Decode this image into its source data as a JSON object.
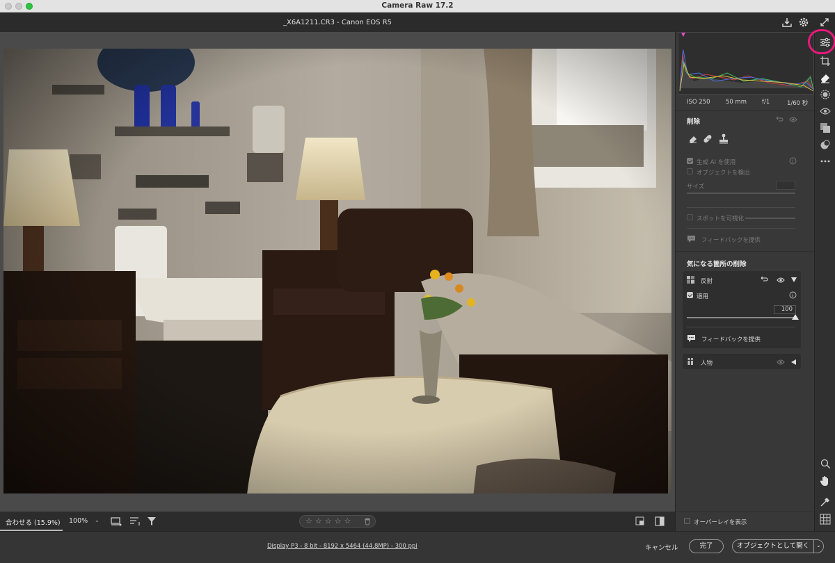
{
  "window": {
    "app_title": "Camera Raw 17.2"
  },
  "header": {
    "file_title": "_X6A1211.CR3  -  Canon EOS R5"
  },
  "histogram_meta": {
    "iso": "ISO 250",
    "focal": "50 mm",
    "aperture": "f/1",
    "shutter": "1/60 秒"
  },
  "remove_panel": {
    "title": "削除",
    "gen_ai_label": "生成 AI を使用",
    "detect_objects_label": "オブジェクトを検出",
    "size_label": "サイズ",
    "visualize_spots_label": "スポットを可視化",
    "feedback_label": "フィードバックを提供"
  },
  "distractions": {
    "title": "気になる箇所の削除",
    "reflections": {
      "label": "反射",
      "apply_label": "適用",
      "amount": "100",
      "feedback_label": "フィードバックを提供"
    },
    "people": {
      "label": "人物"
    }
  },
  "bottombar": {
    "fit_label": "合わせる (15.9%)",
    "zoom_label": "100%",
    "rating_stars": 5
  },
  "overlay": {
    "show_overlay_label": "オーバーレイを表示"
  },
  "status": {
    "info_link": "Display P3 - 8 bit - 8192 x 5464 (44.8MP) - 300 ppi"
  },
  "buttons": {
    "cancel": "キャンセル",
    "done": "完了",
    "open_object": "オブジェクトとして開く"
  },
  "colors": {
    "accent_highlight": "#e8197c",
    "panel_bg": "#383838",
    "canvas_bg": "#4a4a4a"
  }
}
